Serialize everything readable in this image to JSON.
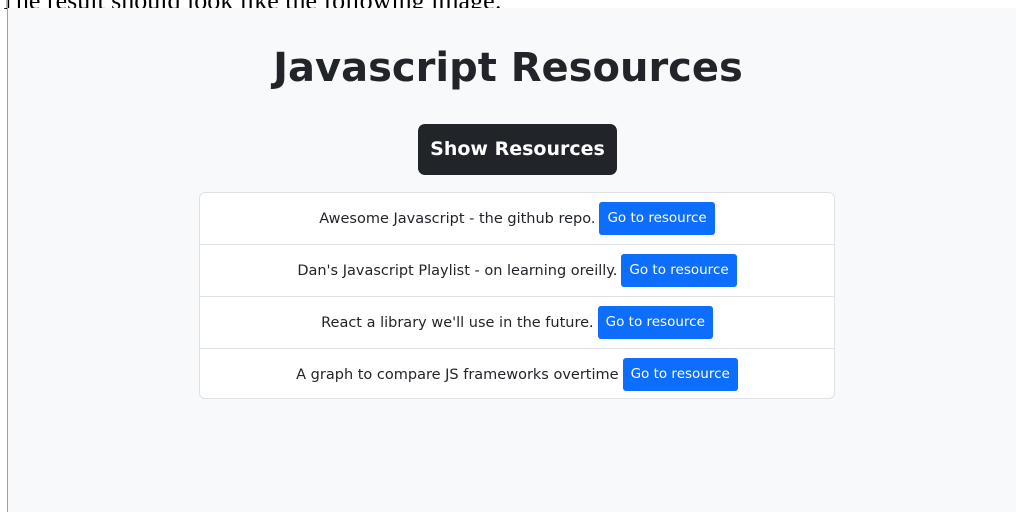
{
  "caption": "The result should look like the following image:",
  "app": {
    "title": "Javascript Resources",
    "show_button_label": "Show Resources"
  },
  "resources": [
    {
      "text": "Awesome Javascript - the github repo.",
      "button_label": "Go to resource"
    },
    {
      "text": "Dan's Javascript Playlist - on learning oreilly.",
      "button_label": "Go to resource"
    },
    {
      "text": "React a library we'll use in the future.",
      "button_label": "Go to resource"
    },
    {
      "text": "A graph to compare JS frameworks overtime",
      "button_label": "Go to resource"
    }
  ],
  "colors": {
    "background": "#f8f9fa",
    "dark_button": "#212529",
    "primary_button": "#0d6efd",
    "border": "#dee2e6"
  }
}
